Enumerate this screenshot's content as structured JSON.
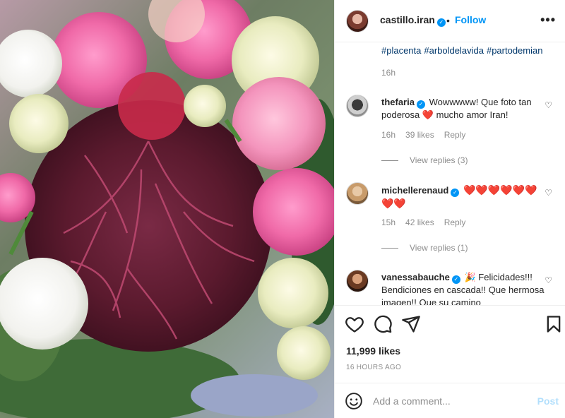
{
  "post": {
    "author": "castillo.iran",
    "follow_label": "Follow",
    "separator": "•",
    "more_label": "•••",
    "verified_mark": "✓"
  },
  "caption": {
    "hashtags": [
      "#placenta",
      "#arboldelavida",
      "#partodemian"
    ],
    "time": "16h"
  },
  "comments": [
    {
      "user": "thefaria",
      "text": "Wowwwww! Que foto tan poderosa ❤️ mucho amor Iran!",
      "time": "16h",
      "likes": "39 likes",
      "reply": "Reply",
      "view_replies": "View replies (3)"
    },
    {
      "user": "michellerenaud",
      "text": "❤️❤️❤️❤️❤️❤️❤️❤️",
      "time": "15h",
      "likes": "42 likes",
      "reply": "Reply",
      "view_replies": "View replies (1)"
    },
    {
      "user": "vanessabauche",
      "text": "🎉 Felicidades!!! Bendiciones en cascada!! Que hermosa imagen!! Que su camino",
      "time": "",
      "likes": "",
      "reply": "",
      "view_replies": ""
    }
  ],
  "like_icon": "heart-outline-icon",
  "stats": {
    "likes": "11,999 likes",
    "posted": "16 HOURS AGO"
  },
  "composer": {
    "placeholder": "Add a comment...",
    "post_label": "Post"
  },
  "colors": {
    "link": "#0095f6",
    "hashtag": "#00376b",
    "heart": "#ed1c24",
    "muted": "#8e8e8e",
    "post_disabled": "#b2dffc"
  }
}
